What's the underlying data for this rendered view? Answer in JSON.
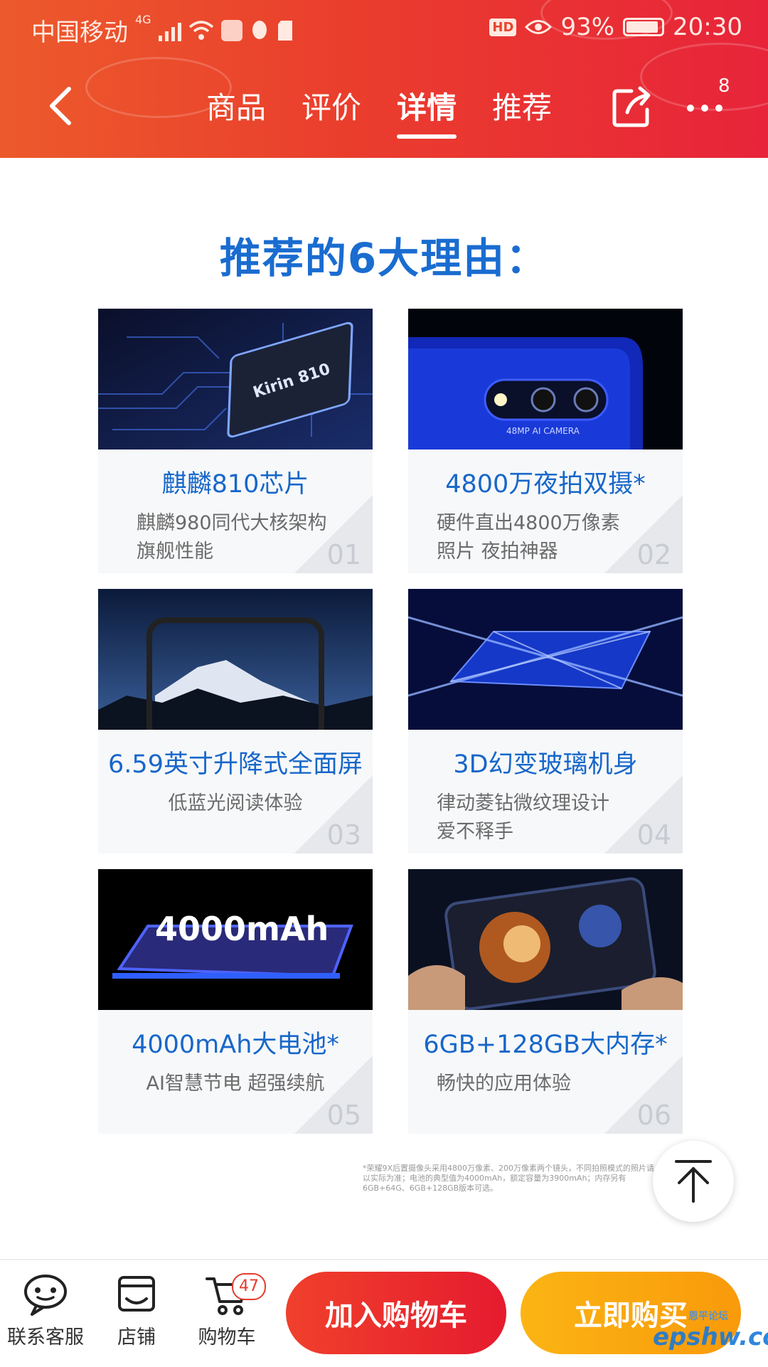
{
  "status_bar": {
    "carrier": "中国移动",
    "network": "4G",
    "hd": "HD",
    "battery": "93%",
    "time": "20:30"
  },
  "nav": {
    "tabs": [
      "商品",
      "评价",
      "详情",
      "推荐"
    ],
    "active_tab_index": 2,
    "more_badge": "8"
  },
  "content": {
    "title": "推荐的6大理由："
  },
  "cards": [
    {
      "title": "麒麟810芯片",
      "subtitle": [
        "麒麟980同代大核架构",
        "旗舰性能"
      ],
      "number": "01",
      "image_text": "Kirin 810",
      "image_icon": "chip-image"
    },
    {
      "title": "4800万夜拍双摄*",
      "subtitle": [
        "硬件直出4800万像素",
        "照片 夜拍神器"
      ],
      "number": "02",
      "image_text": "48MP AI CAMERA",
      "image_icon": "camera-image"
    },
    {
      "title": "6.59英寸升降式全面屏",
      "subtitle": [
        "低蓝光阅读体验"
      ],
      "number": "03",
      "image_text": "",
      "image_icon": "fullscreen-phone-image"
    },
    {
      "title": "3D幻变玻璃机身",
      "subtitle": [
        "律动菱钻微纹理设计",
        "爱不释手"
      ],
      "number": "04",
      "image_text": "",
      "image_icon": "glass-back-image"
    },
    {
      "title": "4000mAh大电池*",
      "subtitle": [
        "AI智慧节电 超强续航"
      ],
      "number": "05",
      "image_text": "4000mAh",
      "image_icon": "battery-phone-image"
    },
    {
      "title": "6GB+128GB大内存*",
      "subtitle": [
        "畅快的应用体验"
      ],
      "number": "06",
      "image_text": "",
      "image_icon": "gaming-phone-image"
    }
  ],
  "footnote": "*荣耀9X后置摄像头采用4800万像素、200万像素两个镜头，不同拍照模式的照片请以实际为准；电池的典型值为4000mAh，额定容量为3900mAh；内存另有6GB+64G、6GB+128GB版本可选。",
  "bottom_bar": {
    "customer_service": "联系客服",
    "store": "店铺",
    "cart": "购物车",
    "cart_count": "47",
    "add_to_cart": "加入购物车",
    "buy_now": "立即购买"
  },
  "watermark": {
    "text": "epshw.com",
    "caption": "恩平论坛"
  },
  "colors": {
    "header_start": "#ec5a2c",
    "header_end": "#e8243a",
    "title_blue": "#1a6cd0",
    "cart_button": "#e51b2e",
    "buy_button": "#fbb414"
  }
}
